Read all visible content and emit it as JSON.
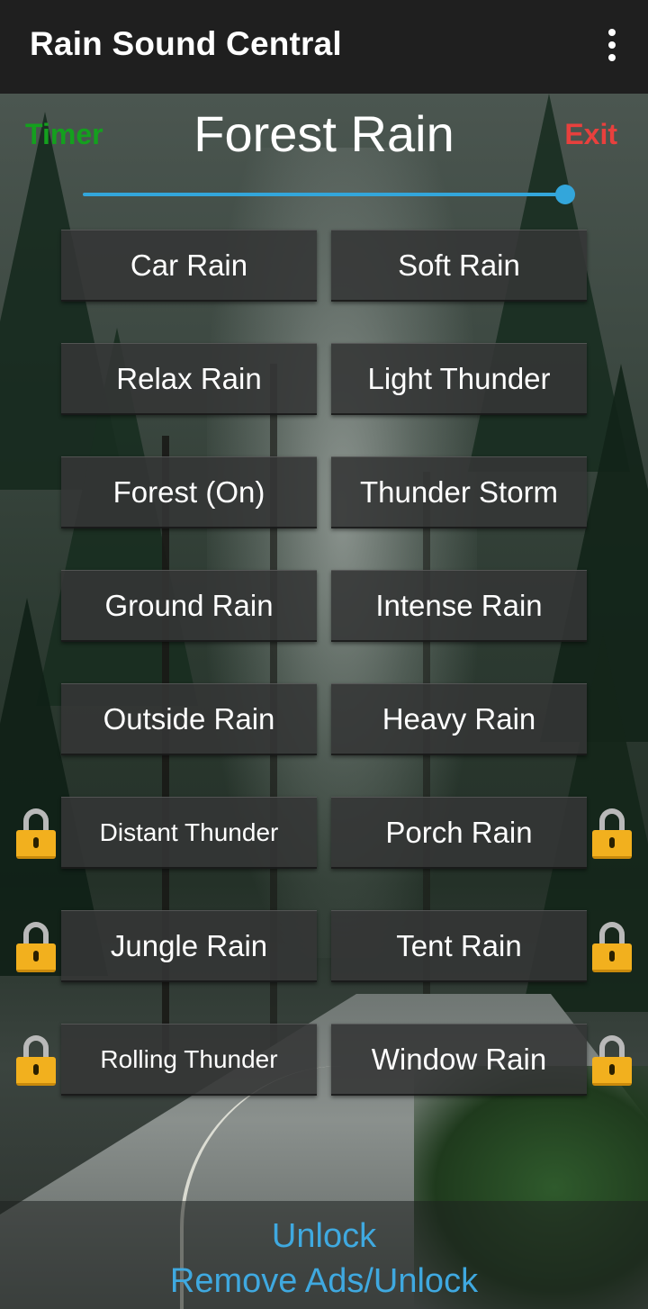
{
  "app_bar": {
    "title": "Rain Sound Central",
    "menu_icon": "overflow-menu-icon"
  },
  "header": {
    "timer_label": "Timer",
    "now_playing": "Forest Rain",
    "exit_label": "Exit",
    "volume_level": 1.0
  },
  "sounds": [
    {
      "label": "Car Rain",
      "locked": false
    },
    {
      "label": "Soft Rain",
      "locked": false
    },
    {
      "label": "Relax Rain",
      "locked": false
    },
    {
      "label": "Light Thunder",
      "locked": false
    },
    {
      "label": "Forest (On)",
      "locked": false
    },
    {
      "label": "Thunder Storm",
      "locked": false
    },
    {
      "label": "Ground Rain",
      "locked": false
    },
    {
      "label": "Intense Rain",
      "locked": false
    },
    {
      "label": "Outside Rain",
      "locked": false
    },
    {
      "label": "Heavy Rain",
      "locked": false
    },
    {
      "label": "Distant Thunder",
      "locked": true
    },
    {
      "label": "Porch Rain",
      "locked": true
    },
    {
      "label": "Jungle Rain",
      "locked": true
    },
    {
      "label": "Tent Rain",
      "locked": true
    },
    {
      "label": "Rolling Thunder",
      "locked": true
    },
    {
      "label": "Window Rain",
      "locked": true
    }
  ],
  "footer": {
    "unlock_label": "Unlock",
    "remove_ads_label": "Remove Ads/Unlock"
  },
  "colors": {
    "timer": "#14a01e",
    "exit": "#e8403d",
    "accent": "#33a6db",
    "lock": "#f2b01e"
  }
}
